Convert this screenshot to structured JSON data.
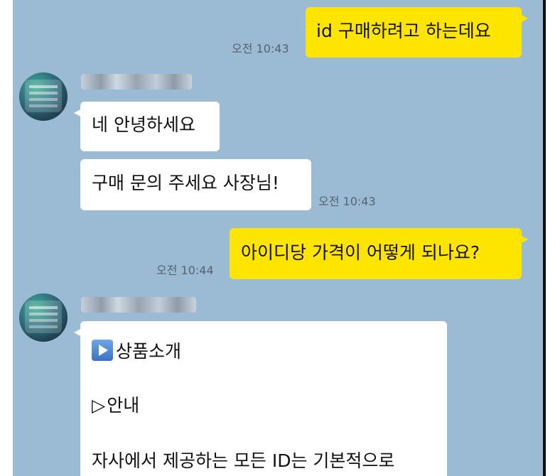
{
  "messages": [
    {
      "sender": "me",
      "text": "id 구매하려고 하는데요",
      "time": "오전 10:43"
    },
    {
      "sender": "other",
      "text": "네 안녕하세요"
    },
    {
      "sender": "other",
      "text": "구매 문의 주세요 사장님!",
      "time": "오전 10:43"
    },
    {
      "sender": "me",
      "text": "아이디당 가격이 어떻게 되나요?",
      "time": "오전 10:44"
    },
    {
      "sender": "other",
      "lines": {
        "heading_icon": "play-button-icon",
        "heading": "상품소개",
        "sub_icon": "▷",
        "sub": "안내",
        "body": "자사에서 제공하는 모든 ID는 기본적으로"
      }
    }
  ]
}
